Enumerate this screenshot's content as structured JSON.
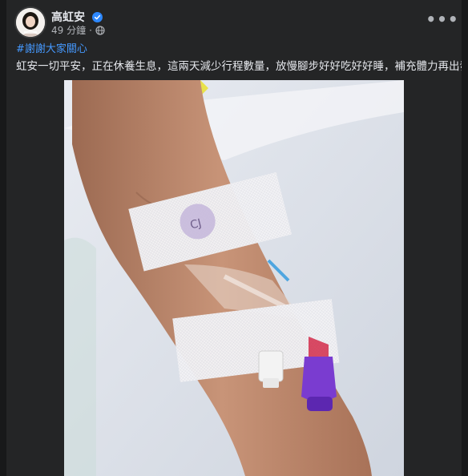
{
  "post": {
    "author": "高虹安",
    "timestamp": "49 分鐘",
    "separator": "·",
    "hashtag": "#謝謝大家關心",
    "text": "虹安一切平安，正在休養生息，這兩天減少行程數量，放慢腳步好好吃好好睡，補充體力再出發。",
    "more_label": "•••",
    "icons": {
      "avatar": "profile-photo",
      "verified": "verified-badge-icon",
      "privacy": "globe-icon",
      "more": "more-options-icon"
    },
    "colors": {
      "page_bg": "#18191a",
      "card_bg": "#242526",
      "text_primary": "#e4e6eb",
      "text_secondary": "#b0b3b8",
      "link": "#4599ff",
      "verified": "#2d88ff"
    },
    "photo": {
      "tape_label": "CJ"
    }
  }
}
